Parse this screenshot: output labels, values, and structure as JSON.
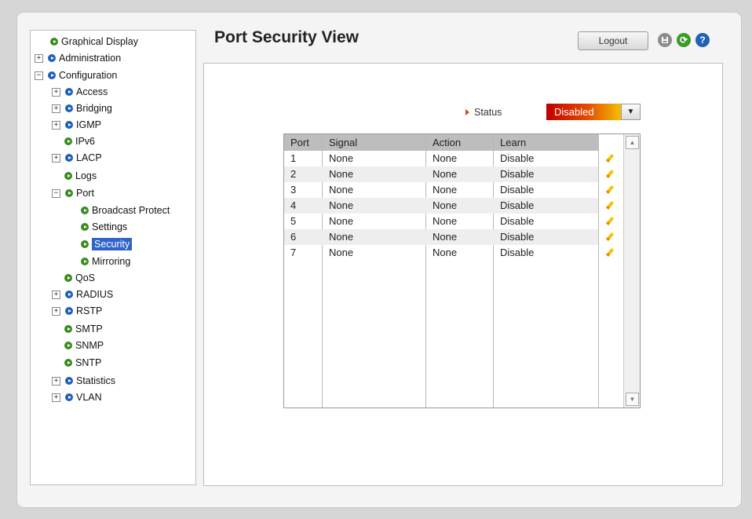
{
  "header": {
    "title": "Port Security View",
    "logout_label": "Logout",
    "icons": [
      "save-icon",
      "refresh-icon",
      "help-icon"
    ],
    "refresh_glyph": "⟳",
    "help_glyph": "?"
  },
  "tree": {
    "items": [
      {
        "label": "Graphical Display",
        "expander": ""
      },
      {
        "label": "Administration",
        "expander": "+"
      },
      {
        "label": "Configuration",
        "expander": "−"
      },
      {
        "label": "Access",
        "expander": "+"
      },
      {
        "label": "Bridging",
        "expander": "+"
      },
      {
        "label": "IGMP",
        "expander": "+"
      },
      {
        "label": "IPv6",
        "expander": ""
      },
      {
        "label": "LACP",
        "expander": "+"
      },
      {
        "label": "Logs",
        "expander": ""
      },
      {
        "label": "Port",
        "expander": "−"
      },
      {
        "label": "Broadcast Protect",
        "expander": ""
      },
      {
        "label": "Settings",
        "expander": ""
      },
      {
        "label": "Security",
        "expander": "",
        "selected": true
      },
      {
        "label": "Mirroring",
        "expander": ""
      },
      {
        "label": "QoS",
        "expander": ""
      },
      {
        "label": "RADIUS",
        "expander": "+"
      },
      {
        "label": "RSTP",
        "expander": "+"
      },
      {
        "label": "SMTP",
        "expander": ""
      },
      {
        "label": "SNMP",
        "expander": ""
      },
      {
        "label": "SNTP",
        "expander": ""
      },
      {
        "label": "Statistics",
        "expander": "+"
      },
      {
        "label": "VLAN",
        "expander": "+"
      }
    ]
  },
  "status": {
    "label": "Status",
    "value": "Disabled",
    "dropdown_glyph": "▼"
  },
  "table": {
    "headers": [
      "Port",
      "Signal",
      "Action",
      "Learn"
    ],
    "rows": [
      [
        "1",
        "None",
        "None",
        "Disable"
      ],
      [
        "2",
        "None",
        "None",
        "Disable"
      ],
      [
        "3",
        "None",
        "None",
        "Disable"
      ],
      [
        "4",
        "None",
        "None",
        "Disable"
      ],
      [
        "5",
        "None",
        "None",
        "Disable"
      ],
      [
        "6",
        "None",
        "None",
        "Disable"
      ],
      [
        "7",
        "None",
        "None",
        "Disable"
      ]
    ],
    "row_action_icon": "edit-pencil-icon",
    "scroll_up_glyph": "▲",
    "scroll_down_glyph": "▼"
  },
  "colors": {
    "accent_green": "#3a8a22",
    "accent_blue": "#1f5fb8",
    "selection": "#2f63c8",
    "status_gradient_start": "#c00000",
    "status_gradient_end": "#f2c000"
  }
}
